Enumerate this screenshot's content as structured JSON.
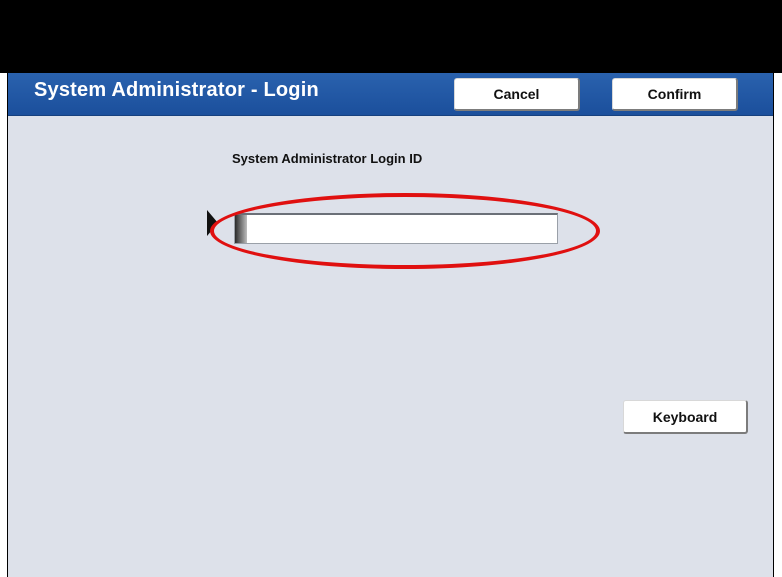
{
  "header": {
    "title": "System Administrator - Login",
    "cancel_label": "Cancel",
    "confirm_label": "Confirm"
  },
  "form": {
    "field_label": "System Administrator Login ID",
    "login_id_value": ""
  },
  "actions": {
    "keyboard_label": "Keyboard"
  },
  "colors": {
    "title_bar": "#1b4f9c",
    "screen_background": "#dde1ea",
    "highlight_annotation": "#e01010"
  }
}
